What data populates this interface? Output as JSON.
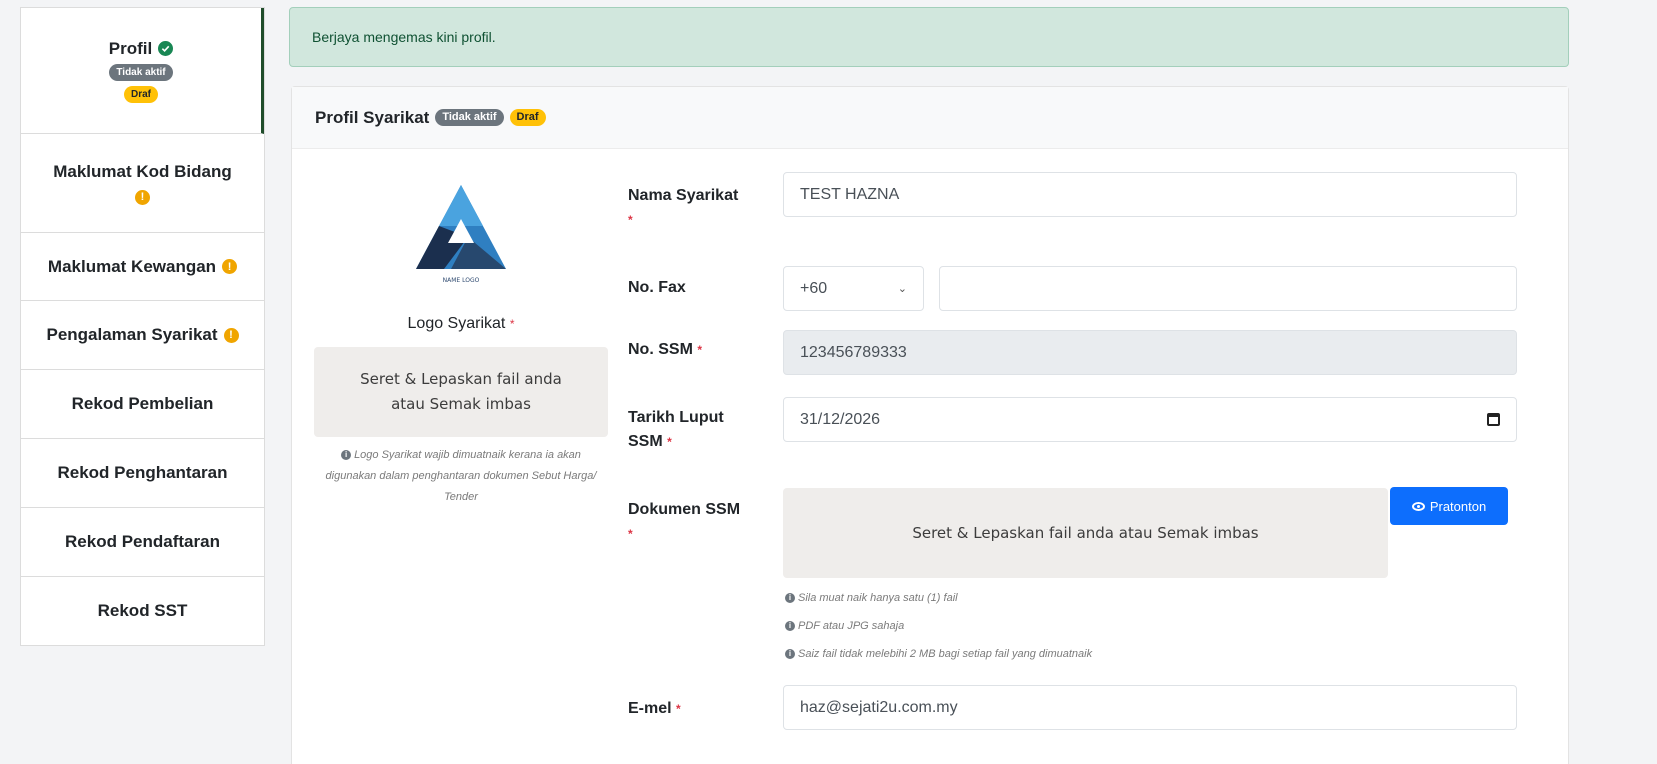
{
  "sidebar": {
    "items": [
      {
        "label": "Profil",
        "status_icon": "check-icon",
        "badges": [
          "Tidak aktif",
          "Draf"
        ]
      },
      {
        "label": "Maklumat Kod Bidang",
        "status_icon": "warning-icon"
      },
      {
        "label": "Maklumat Kewangan",
        "status_icon": "warning-icon"
      },
      {
        "label": "Pengalaman Syarikat",
        "status_icon": "warning-icon"
      },
      {
        "label": "Rekod Pembelian"
      },
      {
        "label": "Rekod Penghantaran"
      },
      {
        "label": "Rekod Pendaftaran"
      },
      {
        "label": "Rekod SST"
      }
    ]
  },
  "alert": {
    "message": "Berjaya mengemas kini profil."
  },
  "card": {
    "title": "Profil Syarikat",
    "badges": [
      "Tidak aktif",
      "Draf"
    ],
    "logo": {
      "brand_text": "NAME LOGO",
      "label": "Logo Syarikat",
      "dropzone_line1": "Seret & Lepaskan fail anda",
      "dropzone_line2": "atau Semak imbas",
      "note": "Logo Syarikat wajib dimuatnaik kerana ia akan digunakan dalam penghantaran dokumen Sebut Harga/ Tender"
    },
    "fields": {
      "nama_label": "Nama Syarikat",
      "nama_value": "TEST HAZNA",
      "fax_label": "No. Fax",
      "fax_code": "+60",
      "fax_value": "",
      "ssm_label": "No. SSM",
      "ssm_value": "123456789333",
      "luput_label_1": "Tarikh Luput",
      "luput_label_2": "SSM",
      "luput_value": "31/12/2026",
      "dokumen_label": "Dokumen SSM",
      "dokumen_dropzone": "Seret & Lepaskan fail anda atau Semak imbas",
      "preview_button": "Pratonton",
      "notes": [
        "Sila muat naik hanya satu (1) fail",
        "PDF atau JPG sahaja",
        "Saiz fail tidak melebihi 2 MB bagi setiap fail yang dimuatnaik"
      ],
      "email_label": "E-mel",
      "email_value": "haz@sejati2u.com.my"
    },
    "required_mark": "*"
  },
  "colors": {
    "success_bg": "#d1e7dd",
    "primary": "#0d6efd",
    "badge_grey": "#6c757d",
    "badge_yellow": "#ffc107",
    "logo_blue": "#2f7fc1",
    "logo_navy": "#1b2f4e"
  }
}
